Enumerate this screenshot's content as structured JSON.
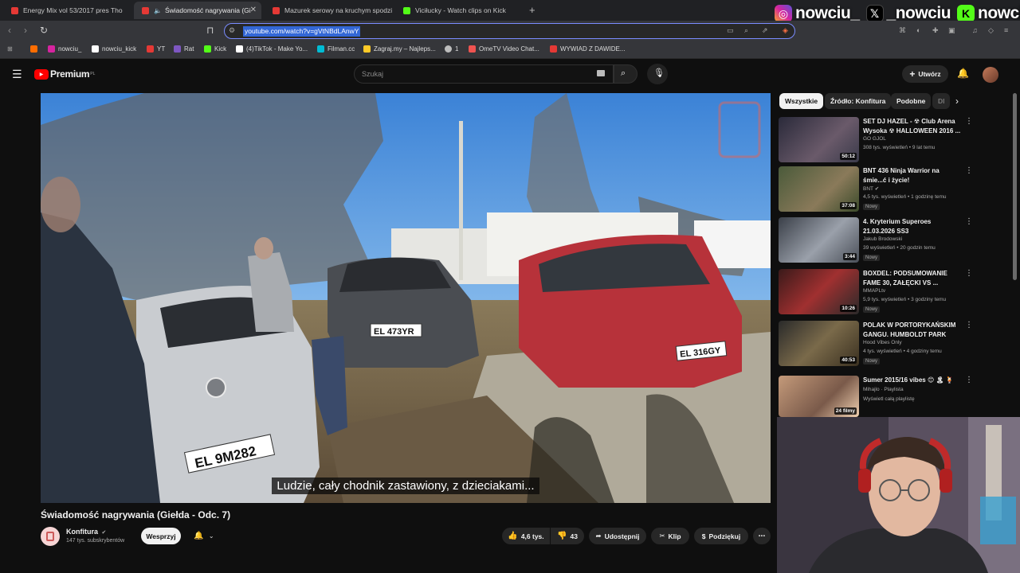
{
  "browser": {
    "tabs": [
      {
        "title": "Energy Mix vol 53/2017 pres Tho",
        "color": "#e53935",
        "active": false
      },
      {
        "title": "Świadomość nagrywania (Gi",
        "color": "#e53935",
        "active": true
      },
      {
        "title": "Mazurek serowy na kruchym spodzie",
        "color": "#e53935",
        "active": false
      },
      {
        "title": "Viciłucky - Watch clips on Kick",
        "color": "#53fc18",
        "active": false
      }
    ],
    "url": "youtube.com/watch?v=gVtNBdLAnwY",
    "bookmarks": [
      {
        "label": "",
        "color": "#ff6d00"
      },
      {
        "label": "nowciu_",
        "color": "#d6249f"
      },
      {
        "label": "nowciu_kick",
        "color": "#ffffff"
      },
      {
        "label": "YT",
        "color": "#e53935"
      },
      {
        "label": "Rat",
        "color": "#7e57c2"
      },
      {
        "label": "Kick",
        "color": "#53fc18"
      },
      {
        "label": "(4)TikTok - Make Yo...",
        "color": "#ffffff"
      },
      {
        "label": "Filman.cc",
        "color": "#00bcd4"
      },
      {
        "label": "Zagraj.my – Najleps...",
        "color": "#ffca28"
      },
      {
        "label": "1",
        "color": "#bdbdbd"
      },
      {
        "label": "OmeTV Video Chat...",
        "color": "#ef5350"
      },
      {
        "label": "WYWIAD Z DAWIDE...",
        "color": "#e53935"
      }
    ]
  },
  "socials": [
    {
      "icon": "instagram-icon",
      "name": "nowciu_",
      "color": "#d6249f"
    },
    {
      "icon": "x-icon",
      "name": "_nowciu",
      "color": "#000000"
    },
    {
      "icon": "kick-icon",
      "name": "nowciu",
      "color": "#53fc18"
    }
  ],
  "yt": {
    "logo_text": "Premium",
    "logo_sup": "PL",
    "search_placeholder": "Szukaj",
    "create_label": "Utwórz"
  },
  "video": {
    "subtitle": "Ludzie, cały chodnik zastawiony, z dzieciakami...",
    "title": "Świadomość nagrywania (Giełda - Odc. 7)",
    "channel": "Konfitura",
    "subscribers": "147 tys. subskrybentów",
    "support_label": "Wesprzyj",
    "likes": "4,6 tys.",
    "dislikes": "43",
    "share_label": "Udostępnij",
    "clip_label": "Klip",
    "thanks_label": "Podziękuj",
    "plates": [
      "EL 9M282",
      "EL 473YR",
      "EL 316GY"
    ]
  },
  "sidebar": {
    "chips": [
      "Wszystkie",
      "Źródło: Konfitura",
      "Podobne",
      "Dl"
    ],
    "recommendations": [
      {
        "title": "SET DJ HAZEL - ☢ Club Arena Wysoka ☢ HALLOWEEN 2016 ...",
        "channel": "GO GJOL",
        "meta": "308 tys. wyświetleń • 9 lat temu",
        "duration": "50:12",
        "badge": "",
        "thumb": "#3a3a4a"
      },
      {
        "title": "BNT 436 Ninja Warrior na śmie...ć i życie!",
        "channel": "BNT ✔",
        "meta": "4,5 tys. wyświetleń • 1 godzinę temu",
        "duration": "37:08",
        "badge": "Nowy",
        "thumb": "#5a6a4a"
      },
      {
        "title": "4. Kryterium Superoes 21.03.2026 SS3",
        "channel": "Jakub Brodowski",
        "meta": "39 wyświetleń • 20 godzin temu",
        "duration": "3:44",
        "badge": "Nowy",
        "thumb": "#5a6070"
      },
      {
        "title": "BOXDEL: PODSUMOWANIE FAME 30, ZAŁĘCKI VS ...",
        "channel": "MMAPLtv",
        "meta": "5,9 tys. wyświetleń • 3 godziny temu",
        "duration": "10:26",
        "badge": "Nowy",
        "thumb": "#4a2a2a"
      },
      {
        "title": "POLAK W PORTORYKAŃSKIM GANGU. HUMBOLDT PARK",
        "channel": "Hood Vibes Only",
        "meta": "4 tys. wyświetleń • 4 godziny temu",
        "duration": "40:53",
        "badge": "Nowy",
        "thumb": "#4a4030"
      },
      {
        "title": "Sumer 2015/16 vibes 😊 🏝 🍹",
        "channel": "Mihajlo · Playlista",
        "meta": "Wyświetl całą playlistę",
        "duration": "24 filmy",
        "badge": "",
        "thumb": "#7a5a4a"
      }
    ]
  }
}
